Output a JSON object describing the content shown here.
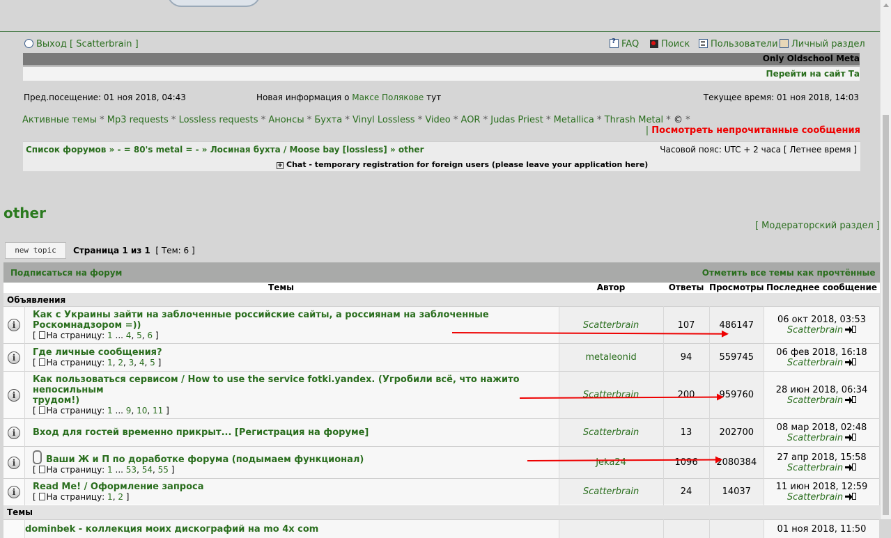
{
  "header": {
    "logout": "Выход",
    "username": "Scatterbrain",
    "faq": "FAQ",
    "search": "Поиск",
    "users": "Пользователи",
    "personal": "Личный раздел",
    "banner_text": "Only Oldschool Meta",
    "go_site": "Перейти на сайт Та"
  },
  "info": {
    "last_visit": "Пред.посещение: 01 ноя 2018, 04:43",
    "news_prefix": "Новая информация о",
    "news_link": "Максе Полякове",
    "news_suffix": "тут",
    "current_time": "Текущее время: 01 ноя 2018, 14:03"
  },
  "quicklinks": [
    "Активные темы",
    "Mp3 requests",
    "Lossless requests",
    "Анонсы",
    "Бухта",
    "Vinyl Lossless",
    "Video",
    "AOR",
    "Judas Priest",
    "Metallica",
    "Thrash Metal"
  ],
  "copyright": "©",
  "unread": "Посмотреть непрочитанные сообщения",
  "breadcrumb": {
    "root": "Список форумов",
    "c1": "- = 80's metal = -",
    "c2": "Лосиная бухта / Moose bay [lossless]",
    "c3": "other"
  },
  "timezone": {
    "label": "Часовой пояс: UTC + 2 часа",
    "dst": "Летнее время"
  },
  "chat_link": "Chat - temporary registration for foreign users (please leave your application here)",
  "forum": {
    "title": "other",
    "moderator": "Модераторский раздел",
    "new_topic": "new topic",
    "page_info": "Страница 1 из 1",
    "topics_count": "Тем: 6",
    "subscribe": "Подписаться на форум",
    "mark_read": "Отметить все темы как прочтённые"
  },
  "columns": {
    "topics": "Темы",
    "author": "Автор",
    "replies": "Ответы",
    "views": "Просмотры",
    "last": "Последнее сообщение"
  },
  "sections": {
    "announcements": "Объявления",
    "topics": "Темы"
  },
  "topics": [
    {
      "title": "Как с Украины зайти на заблоченные российские сайты, а россиянам на заблоченные Роскомнадзором =))",
      "pages_label": "На страницу:",
      "pages": [
        "1",
        "...",
        "4",
        "5",
        "6"
      ],
      "author": "Scatterbrain",
      "replies": "107",
      "views": "486147",
      "last_date": "06 окт 2018, 03:53",
      "last_author": "Scatterbrain"
    },
    {
      "title": "Где личные сообщения?",
      "pages_label": "На страницу:",
      "pages": [
        "1",
        "2",
        "3",
        "4",
        "5"
      ],
      "author": "metaleonid",
      "replies": "94",
      "views": "559745",
      "last_date": "06 фев 2018, 16:18",
      "last_author": "Scatterbrain"
    },
    {
      "title_line1": "Как пользоваться сервисом / How to use the service fotki.yandex. (Угробили всё, что нажито непосильным",
      "title_line2": "трудом!)",
      "pages_label": "На страницу:",
      "pages": [
        "1",
        "...",
        "9",
        "10",
        "11"
      ],
      "author": "Scatterbrain",
      "replies": "200",
      "views": "959760",
      "last_date": "28 июн 2018, 06:34",
      "last_author": "Scatterbrain"
    },
    {
      "title": "Вход для гостей временно прикрыт... [Регистрация на форуме]",
      "author": "Scatterbrain",
      "replies": "13",
      "views": "202700",
      "last_date": "08 мар 2018, 02:48",
      "last_author": "Scatterbrain"
    },
    {
      "title": "Ваши Ж и П по доработке форума (подымаем функционал)",
      "pages_label": "На страницу:",
      "pages": [
        "1",
        "...",
        "53",
        "54",
        "55"
      ],
      "author": "Jeka24",
      "replies": "1096",
      "views": "2080384",
      "last_date": "27 апр 2018, 15:58",
      "last_author": "Scatterbrain"
    },
    {
      "title": "Read Me! / Оформление запроса",
      "pages_label": "На страницу:",
      "pages": [
        "1",
        "2"
      ],
      "author": "Scatterbrain",
      "replies": "24",
      "views": "14037",
      "last_date": "11 июн 2018, 12:59",
      "last_author": "Scatterbrain"
    }
  ],
  "partial_row": {
    "title": "dominbek - коллекция моих дискографий на mo 4x com",
    "date": "01 ноя 2018, 11:50"
  }
}
